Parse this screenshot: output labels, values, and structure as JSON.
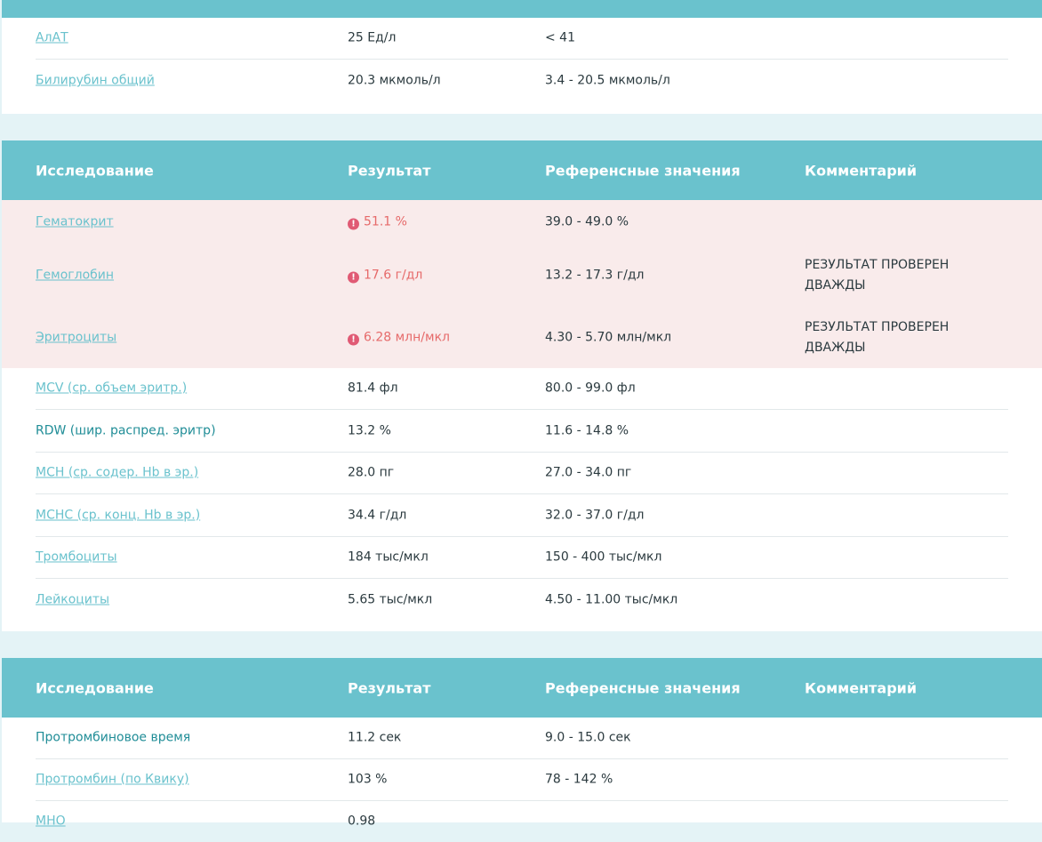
{
  "table_headers": {
    "col1": "Исследование",
    "col2": "Результат",
    "col3": "Референсные значения",
    "col4": "Комментарий"
  },
  "section1": {
    "rows": [
      {
        "name": "АлАТ",
        "result": "25 Ед/л",
        "ref": "< 41",
        "comment": ""
      },
      {
        "name": "Билирубин общий",
        "result": "20.3 мкмоль/л",
        "ref": "3.4 - 20.5 мкмоль/л",
        "comment": ""
      }
    ]
  },
  "section2": {
    "rows": [
      {
        "name": "Гематокрит",
        "result": "51.1 %",
        "ref": "39.0 - 49.0 %",
        "comment": "",
        "flag": "high"
      },
      {
        "name": "Гемоглобин",
        "result": "17.6 г/дл",
        "ref": "13.2 - 17.3 г/дл",
        "comment": "РЕЗУЛЬТАТ ПРОВЕРЕН ДВАЖДЫ",
        "flag": "high"
      },
      {
        "name": "Эритроциты",
        "result": "6.28 млн/мкл",
        "ref": "4.30 - 5.70 млн/мкл",
        "comment": "РЕЗУЛЬТАТ ПРОВЕРЕН ДВАЖДЫ",
        "flag": "high"
      },
      {
        "name": "MCV (ср. объем эритр.)",
        "result": "81.4 фл",
        "ref": "80.0 - 99.0 фл",
        "comment": ""
      },
      {
        "name": "RDW (шир. распред. эритр)",
        "result": "13.2 %",
        "ref": "11.6 - 14.8 %",
        "comment": ""
      },
      {
        "name": "MCH (ср. содер. Hb в эр.)",
        "result": "28.0 пг",
        "ref": "27.0 - 34.0 пг",
        "comment": ""
      },
      {
        "name": "MCHC (ср. конц. Hb в эр.)",
        "result": "34.4 г/дл",
        "ref": "32.0 - 37.0 г/дл",
        "comment": ""
      },
      {
        "name": "Тромбоциты",
        "result": "184 тыс/мкл",
        "ref": "150 - 400 тыс/мкл",
        "comment": ""
      },
      {
        "name": "Лейкоциты",
        "result": "5.65 тыс/мкл",
        "ref": "4.50 - 11.00 тыс/мкл",
        "comment": ""
      }
    ]
  },
  "section3": {
    "rows": [
      {
        "name": "Протромбиновое время",
        "result": "11.2 сек",
        "ref": "9.0 - 15.0 сек",
        "comment": ""
      },
      {
        "name": "Протромбин (по Квику)",
        "result": "103 %",
        "ref": "78 - 142 %",
        "comment": ""
      },
      {
        "name": "МНО",
        "result": "0.98",
        "ref": "",
        "comment": ""
      }
    ]
  },
  "icons": {
    "alert": "exclamation-circle-icon"
  },
  "colors": {
    "header": "#6ac2cd",
    "link": "#6ac2cd",
    "alert_bg": "#f9ebeb",
    "alert_text": "#e66a6a"
  }
}
